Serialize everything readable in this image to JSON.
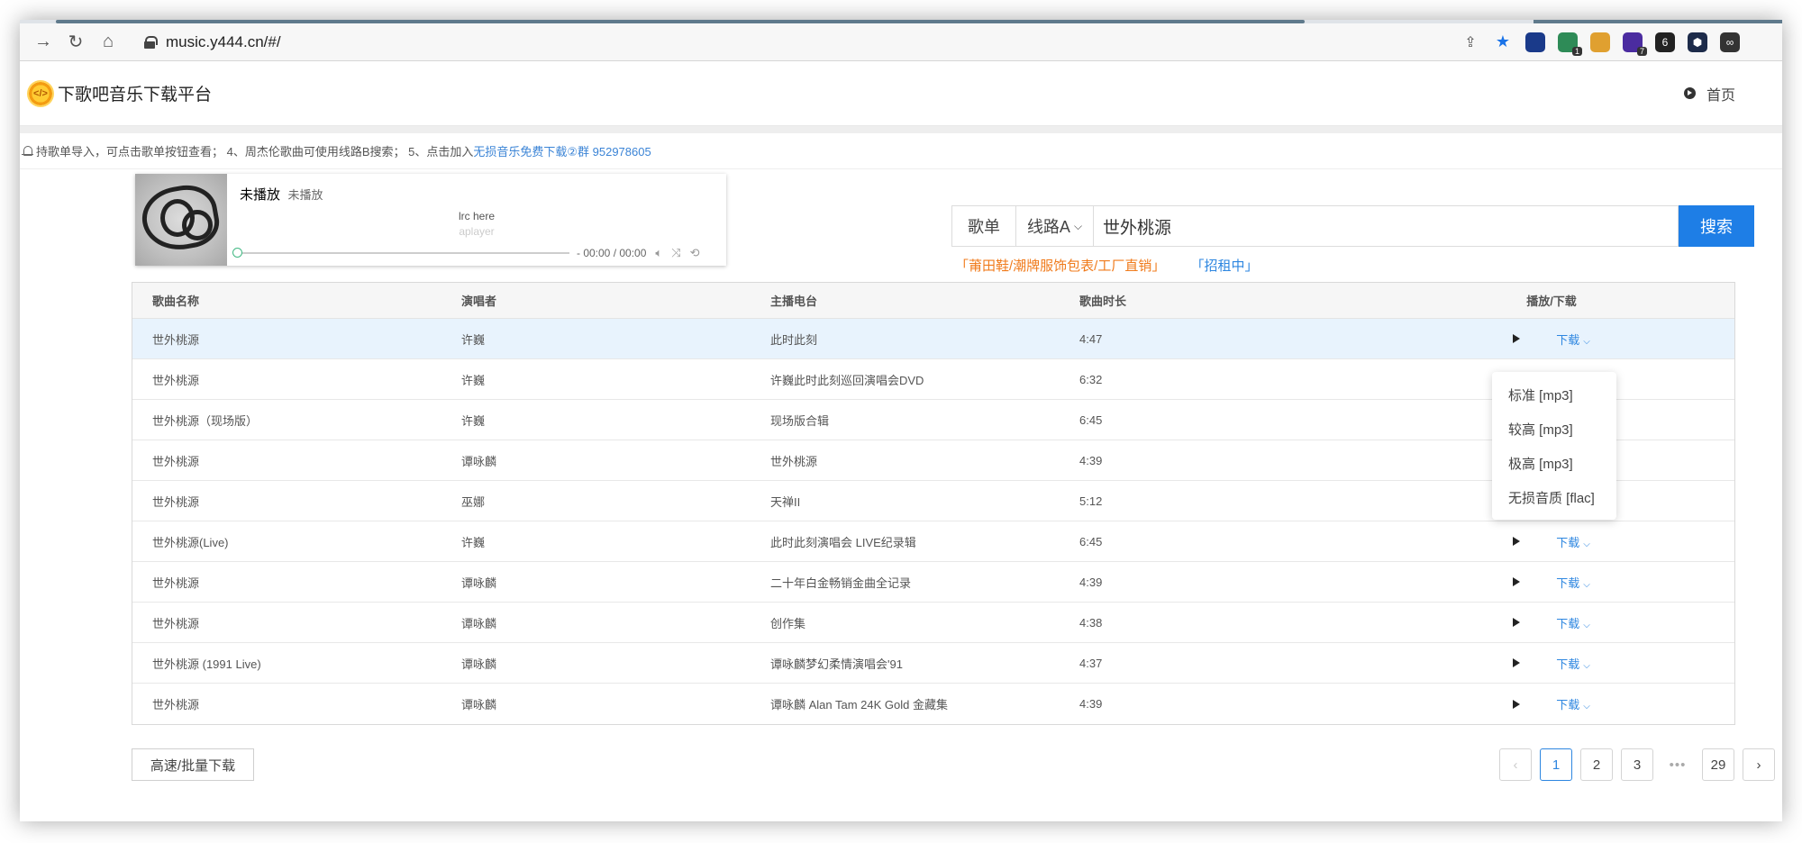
{
  "browser": {
    "url": "music.y444.cn/#/",
    "extensions": [
      {
        "name": "bitwarden",
        "color": "#1a3a8a",
        "badge": ""
      },
      {
        "name": "shield-green",
        "color": "#2e8b57",
        "badge": "1"
      },
      {
        "name": "globe-multicolor",
        "color": "#e0a030",
        "badge": ""
      },
      {
        "name": "stack-purple",
        "color": "#4b2ca0",
        "badge": "7"
      },
      {
        "name": "info-dark",
        "color": "#222222",
        "badge": ""
      },
      {
        "name": "hexagon-dark",
        "color": "#1d2b4a",
        "badge": ""
      },
      {
        "name": "glasses",
        "color": "#333333",
        "badge": ""
      }
    ]
  },
  "site": {
    "title": "下歌吧音乐下载平台",
    "home": "首页"
  },
  "notice": {
    "text": "持歌单导入，可点击歌单按钮查看； 4、周杰伦歌曲可使用线路B搜索； 5、点击加入",
    "link": "无损音乐免费下载②群 952978605"
  },
  "player": {
    "title": "未播放",
    "author": "未播放",
    "lrc": "lrc here",
    "lrc_sub": "aplayer",
    "time": "- 00:00 / 00:00",
    "progress": 0
  },
  "search": {
    "playlist_label": "歌单",
    "line_label": "线路A",
    "query": "世外桃源",
    "submit_label": "搜索",
    "promo1": "「莆田鞋/潮牌服饰包表/工厂直销」",
    "promo2": "「招租中」"
  },
  "table": {
    "headers": [
      "歌曲名称",
      "演唱者",
      "主播电台",
      "歌曲时长",
      "播放/下载"
    ],
    "download_label": "下载",
    "rows": [
      {
        "name": "世外桃源",
        "artist": "许巍",
        "album": "此时此刻",
        "duration": "4:47"
      },
      {
        "name": "世外桃源",
        "artist": "许巍",
        "album": "许巍此时此刻巡回演唱会DVD",
        "duration": "6:32"
      },
      {
        "name": "世外桃源（现场版）",
        "artist": "许巍",
        "album": "现场版合辑",
        "duration": "6:45"
      },
      {
        "name": "世外桃源",
        "artist": "谭咏麟",
        "album": "世外桃源",
        "duration": "4:39"
      },
      {
        "name": "世外桃源",
        "artist": "巫娜",
        "album": "天禅II",
        "duration": "5:12"
      },
      {
        "name": "世外桃源(Live)",
        "artist": "许巍",
        "album": "此时此刻演唱会 LIVE纪录辑",
        "duration": "6:45"
      },
      {
        "name": "世外桃源",
        "artist": "谭咏麟",
        "album": "二十年白金畅销金曲全记录",
        "duration": "4:39"
      },
      {
        "name": "世外桃源",
        "artist": "谭咏麟",
        "album": "创作集",
        "duration": "4:38"
      },
      {
        "name": "世外桃源 (1991 Live)",
        "artist": "谭咏麟",
        "album": "谭咏麟梦幻柔情演唱会'91",
        "duration": "4:37"
      },
      {
        "name": "世外桃源",
        "artist": "谭咏麟",
        "album": "谭咏麟 Alan Tam 24K Gold 金藏集",
        "duration": "4:39"
      }
    ]
  },
  "dropdown": {
    "items": [
      "标准 [mp3]",
      "较高 [mp3]",
      "极高 [mp3]",
      "无损音质 [flac]"
    ]
  },
  "footer": {
    "batch_label": "高速/批量下载",
    "pages": [
      "1",
      "2",
      "3",
      "•••",
      "29"
    ],
    "prev": "‹",
    "next": "›"
  }
}
